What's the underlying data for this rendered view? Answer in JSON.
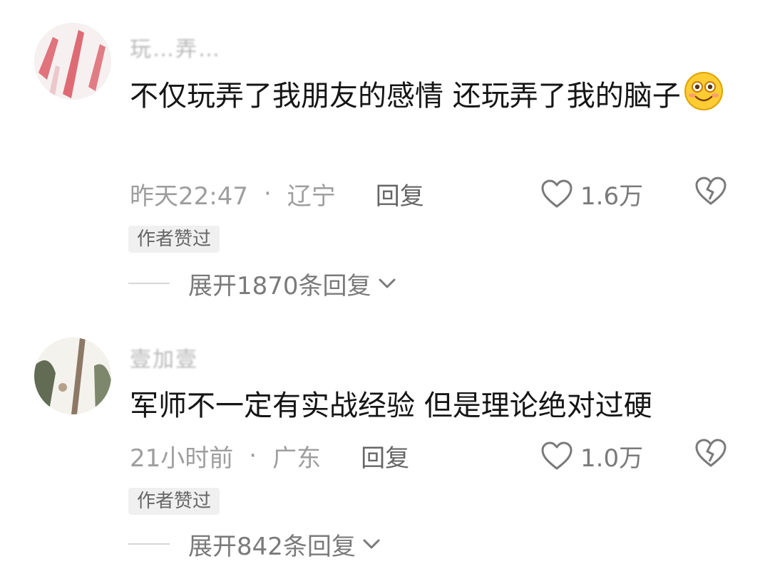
{
  "comments": [
    {
      "username": "玩…弄…",
      "text": "不仅玩弄了我朋友的感情 还玩弄了我的脑子",
      "emoji": "smile-emoji",
      "time": "昨天22:47",
      "separator": "·",
      "location": "辽宁",
      "reply_label": "回复",
      "likes": "1.6万",
      "badge": "作者赞过",
      "expand_label": "展开1870条回复"
    },
    {
      "username": "壹加壹",
      "text": "军师不一定有实战经验 但是理论绝对过硬",
      "time": "21小时前",
      "separator": "·",
      "location": "广东",
      "reply_label": "回复",
      "likes": "1.0万",
      "badge": "作者赞过",
      "expand_label": "展开842条回复"
    }
  ],
  "icons": {
    "like": "heart-outline-icon",
    "dislike": "broken-heart-icon",
    "expand": "chevron-down-icon"
  },
  "colors": {
    "text_primary": "#151515",
    "text_secondary": "#9e9e9e",
    "badge_bg": "#f0f0f0"
  }
}
